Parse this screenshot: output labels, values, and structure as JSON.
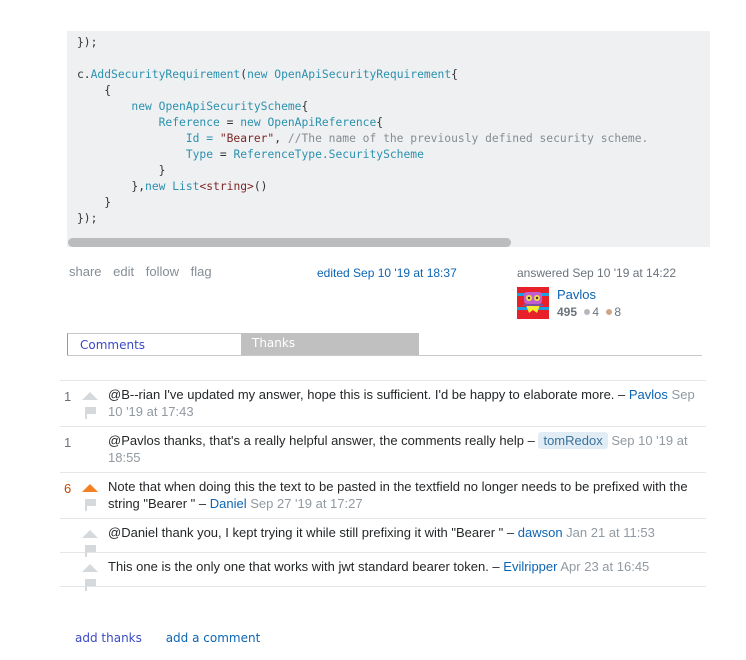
{
  "code": {
    "lines": [
      [
        {
          "t": "});",
          "c": ""
        }
      ],
      [
        {
          "t": "",
          "c": ""
        }
      ],
      [
        {
          "t": "c.",
          "c": ""
        },
        {
          "t": "AddSecurityRequirement",
          "c": "kw"
        },
        {
          "t": "(",
          "c": ""
        },
        {
          "t": "new",
          "c": "kw"
        },
        {
          "t": " ",
          "c": ""
        },
        {
          "t": "OpenApiSecurityRequirement",
          "c": "typ"
        },
        {
          "t": "{",
          "c": ""
        }
      ],
      [
        {
          "t": "    {",
          "c": ""
        }
      ],
      [
        {
          "t": "        ",
          "c": ""
        },
        {
          "t": "new",
          "c": "kw"
        },
        {
          "t": " ",
          "c": ""
        },
        {
          "t": "OpenApiSecurityScheme",
          "c": "typ"
        },
        {
          "t": "{",
          "c": ""
        }
      ],
      [
        {
          "t": "            ",
          "c": ""
        },
        {
          "t": "Reference",
          "c": "kw"
        },
        {
          "t": " = ",
          "c": ""
        },
        {
          "t": "new",
          "c": "kw"
        },
        {
          "t": " ",
          "c": ""
        },
        {
          "t": "OpenApiReference",
          "c": "typ"
        },
        {
          "t": "{",
          "c": ""
        }
      ],
      [
        {
          "t": "                Id = ",
          "c": "kw"
        },
        {
          "t": "\"Bearer\"",
          "c": "str"
        },
        {
          "t": ", ",
          "c": ""
        },
        {
          "t": "//The name of the previously defined security scheme.",
          "c": "cm"
        }
      ],
      [
        {
          "t": "                ",
          "c": ""
        },
        {
          "t": "Type",
          "c": "kw"
        },
        {
          "t": " = ",
          "c": ""
        },
        {
          "t": "ReferenceType.SecurityScheme",
          "c": "typ"
        }
      ],
      [
        {
          "t": "            }",
          "c": ""
        }
      ],
      [
        {
          "t": "        },",
          "c": ""
        },
        {
          "t": "new",
          "c": "kw"
        },
        {
          "t": " ",
          "c": ""
        },
        {
          "t": "List",
          "c": "typ"
        },
        {
          "t": "<string>",
          "c": "str"
        },
        {
          "t": "()",
          "c": ""
        }
      ],
      [
        {
          "t": "    }",
          "c": ""
        }
      ],
      [
        {
          "t": "});",
          "c": ""
        }
      ]
    ],
    "scroll_fraction": 0.69
  },
  "post_menu": [
    "share",
    "edit",
    "follow",
    "flag"
  ],
  "edited": "edited Sep 10 '19 at 18:37",
  "answered": {
    "label": "answered Sep 10 '19 at 14:22",
    "user": "Pavlos",
    "reputation": "495",
    "silver": "4",
    "bronze": "8",
    "silver_color": "#b4b8bc",
    "bronze_color": "#d1a684"
  },
  "tabs": {
    "comments": "Comments",
    "thanks": "Thanks"
  },
  "comments": [
    {
      "score": "1",
      "upvoted": false,
      "text": "@B--rian I've updated my answer, hope this is sufficient. I'd be happy to elaborate more.",
      "sep": " – ",
      "user": "Pavlos",
      "is_op": false,
      "date": "Sep 10 '19 at 17:43"
    },
    {
      "score": "1",
      "upvoted": false,
      "hide_vote": true,
      "text": "@Pavlos thanks, that's a really helpful answer, the comments really help",
      "sep": " – ",
      "user": "tomRedox",
      "is_op": true,
      "date": "Sep 10 '19 at 18:55"
    },
    {
      "score": "6",
      "upvoted": true,
      "text": "Note that when doing this the text to be pasted in the textfield no longer needs to be prefixed with the string \"Bearer \"",
      "sep": " – ",
      "user": "Daniel",
      "is_op": false,
      "date": "Sep 27 '19 at 17:27"
    },
    {
      "score": "",
      "upvoted": false,
      "text": "@Daniel thank you, I kept trying it while still prefixing it with \"Bearer \"",
      "sep": " – ",
      "user": "dawson",
      "is_op": false,
      "date": "Jan 21 at 11:53"
    },
    {
      "score": "",
      "upvoted": false,
      "text": "This one is the only one that works with jwt standard bearer token.",
      "sep": " – ",
      "user": "Evilripper",
      "is_op": false,
      "date": "Apr 23 at 16:45"
    }
  ],
  "links": {
    "add_thanks": "add thanks",
    "add_comment": "add a comment"
  }
}
